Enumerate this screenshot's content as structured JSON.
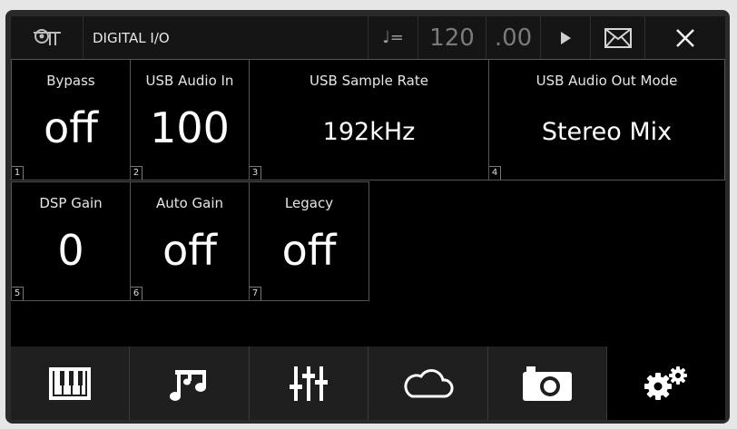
{
  "topbar": {
    "logo_icon": "tree-logo-icon",
    "title": "DIGITAL I/O",
    "tempo_symbol": "♩=",
    "bpm": "120",
    "bpm_decimal": ".00",
    "play_icon": "play-icon",
    "mail_icon": "mail-icon",
    "close_icon": "close-icon"
  },
  "params": [
    {
      "index": "1",
      "label": "Bypass",
      "value": "off"
    },
    {
      "index": "2",
      "label": "USB Audio In",
      "value": "100"
    },
    {
      "index": "3",
      "label": "USB Sample Rate",
      "value": "192kHz"
    },
    {
      "index": "4",
      "label": "USB Audio Out Mode",
      "value": "Stereo Mix"
    },
    {
      "index": "5",
      "label": "DSP Gain",
      "value": "0"
    },
    {
      "index": "6",
      "label": "Auto Gain",
      "value": "off"
    },
    {
      "index": "7",
      "label": "Legacy",
      "value": "off"
    }
  ],
  "bottombar": [
    {
      "icon": "keyboard-icon"
    },
    {
      "icon": "music-notes-icon"
    },
    {
      "icon": "mixer-faders-icon"
    },
    {
      "icon": "cloud-icon"
    },
    {
      "icon": "camera-icon"
    },
    {
      "icon": "settings-gears-icon",
      "active": true
    }
  ]
}
